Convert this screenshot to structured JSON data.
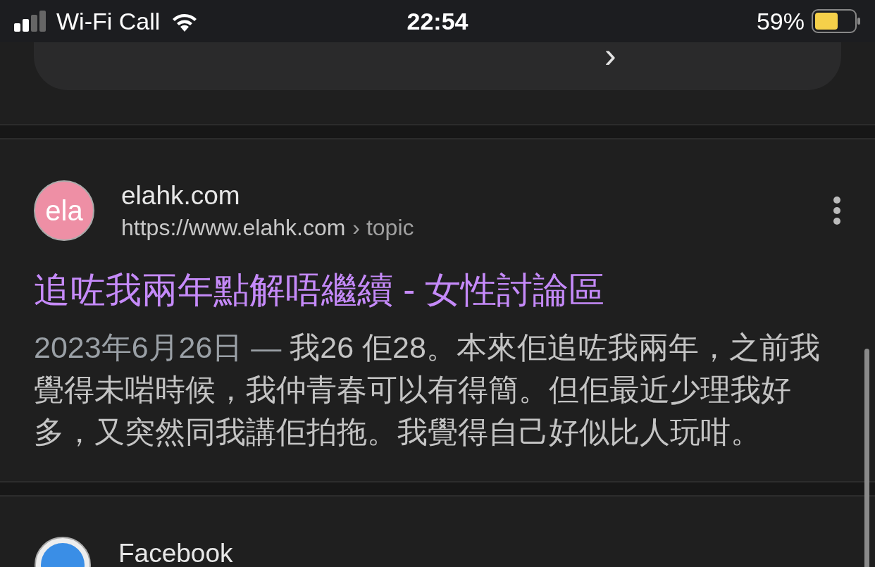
{
  "status_bar": {
    "carrier": "Wi-Fi Call",
    "time": "22:54",
    "battery": "59%"
  },
  "more_link": {
    "arrow": "›"
  },
  "results": [
    {
      "favicon_text": "ela",
      "site": "elahk.com",
      "url": "https://www.elahk.com",
      "breadcrumb": "› topic",
      "title": "追咗我兩年點解唔繼續 - 女性討論區",
      "date": "2023年6月26日 — ",
      "snippet": "我26 佢28。本來佢追咗我兩年，之前我覺得未啱時候，我仲青春可以有得簡。但佢最近少理我好多，又突然同我講佢拍拖。我覺得自己好似比人玩咁。"
    },
    {
      "site": "Facebook"
    }
  ]
}
